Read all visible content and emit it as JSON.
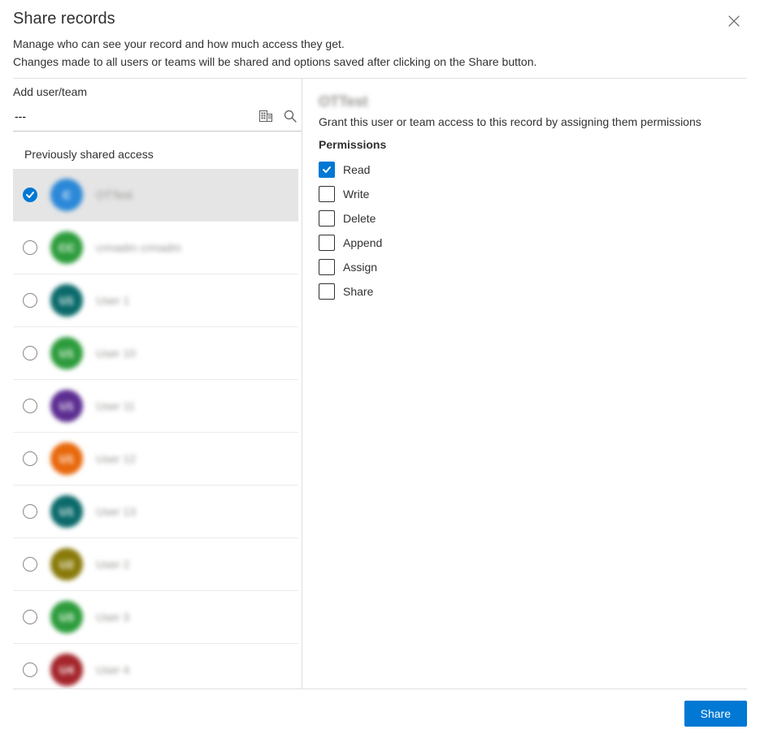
{
  "title": "Share records",
  "subtitle_line1": "Manage who can see your record and how much access they get.",
  "subtitle_line2": "Changes made to all users or teams will be shared and options saved after clicking on the Share button.",
  "left": {
    "add_label": "Add user/team",
    "search_value": "---",
    "prev_label": "Previously shared access"
  },
  "users": [
    {
      "name": "OTTest",
      "initials": "C",
      "color": "#2b88d8",
      "selected": true
    },
    {
      "name": "crmadm crmadm",
      "initials": "CC",
      "color": "#2d9c3c",
      "selected": false
    },
    {
      "name": "User 1",
      "initials": "U1",
      "color": "#0b6a6a",
      "selected": false
    },
    {
      "name": "User 10",
      "initials": "U1",
      "color": "#2d9c3c",
      "selected": false
    },
    {
      "name": "User 11",
      "initials": "U1",
      "color": "#5c2d91",
      "selected": false
    },
    {
      "name": "User 12",
      "initials": "U1",
      "color": "#e8680c",
      "selected": false
    },
    {
      "name": "User 13",
      "initials": "U1",
      "color": "#0b6a6a",
      "selected": false
    },
    {
      "name": "User 2",
      "initials": "U2",
      "color": "#8a7a0a",
      "selected": false
    },
    {
      "name": "User 3",
      "initials": "U3",
      "color": "#2d9c3c",
      "selected": false
    },
    {
      "name": "User 4",
      "initials": "U4",
      "color": "#a4262c",
      "selected": false
    }
  ],
  "right": {
    "selected_name": "OTTest",
    "grant_text": "Grant this user or team access to this record by assigning them permissions",
    "perm_heading": "Permissions"
  },
  "permissions": [
    {
      "label": "Read",
      "checked": true
    },
    {
      "label": "Write",
      "checked": false
    },
    {
      "label": "Delete",
      "checked": false
    },
    {
      "label": "Append",
      "checked": false
    },
    {
      "label": "Assign",
      "checked": false
    },
    {
      "label": "Share",
      "checked": false
    }
  ],
  "footer": {
    "share_label": "Share"
  }
}
